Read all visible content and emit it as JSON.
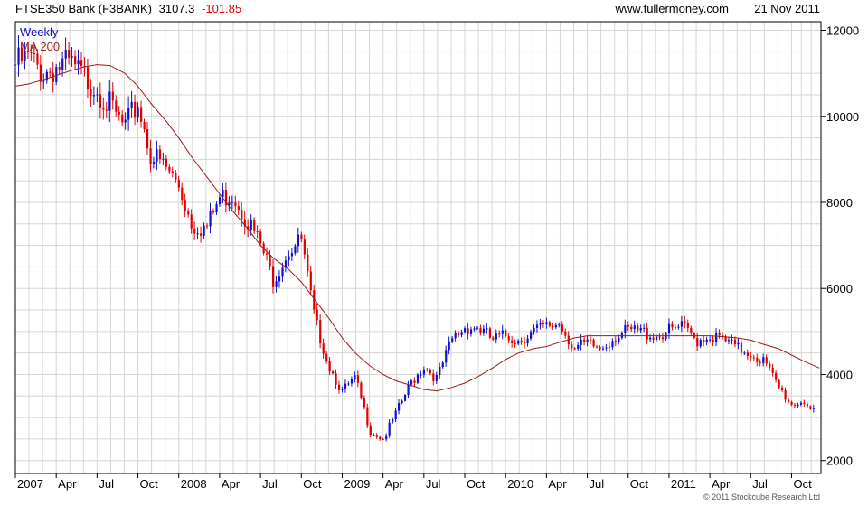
{
  "header": {
    "instrument": "FTSE350 Bank (F3BANK)",
    "last": "3107.3",
    "change": "-101.85",
    "site": "www.fullermoney.com",
    "date": "21 Nov 2011"
  },
  "copyright": "© 2011 Stockcube Research Ltd",
  "colors": {
    "up": "#1010c8",
    "down": "#e00000",
    "ma": "#9b1b1b",
    "grid": "#d6d6d6",
    "frame": "#000000",
    "change": "#e00000",
    "legend_weekly": "#1010c8",
    "legend_ma": "#9b1b1b"
  },
  "chart_data": {
    "type": "line",
    "title": "FTSE350 Bank (F3BANK)",
    "xlabel": "",
    "ylabel": "",
    "xlim": [
      2007.0,
      2011.93
    ],
    "ylim": [
      1700,
      12200
    ],
    "y_axis_side": "right",
    "yticks": [
      2000,
      4000,
      6000,
      8000,
      10000,
      12000
    ],
    "ytick_labels": [
      "2000",
      "4000",
      "6000",
      "8000",
      "10000",
      "12000"
    ],
    "xticks": [
      {
        "x": 2007.0,
        "label": "2007"
      },
      {
        "x": 2007.25,
        "label": "Apr"
      },
      {
        "x": 2007.5,
        "label": "Jul"
      },
      {
        "x": 2007.75,
        "label": "Oct"
      },
      {
        "x": 2008.0,
        "label": "2008"
      },
      {
        "x": 2008.25,
        "label": "Apr"
      },
      {
        "x": 2008.5,
        "label": "Jul"
      },
      {
        "x": 2008.75,
        "label": "Oct"
      },
      {
        "x": 2009.0,
        "label": "2009"
      },
      {
        "x": 2009.25,
        "label": "Apr"
      },
      {
        "x": 2009.5,
        "label": "Jul"
      },
      {
        "x": 2009.75,
        "label": "Oct"
      },
      {
        "x": 2010.0,
        "label": "2010"
      },
      {
        "x": 2010.25,
        "label": "Apr"
      },
      {
        "x": 2010.5,
        "label": "Jul"
      },
      {
        "x": 2010.75,
        "label": "Oct"
      },
      {
        "x": 2011.0,
        "label": "2011"
      },
      {
        "x": 2011.25,
        "label": "Apr"
      },
      {
        "x": 2011.5,
        "label": "Jul"
      },
      {
        "x": 2011.75,
        "label": "Oct"
      }
    ],
    "grid": true,
    "legend": "top-left",
    "series": [
      {
        "name": "Weekly",
        "style": "candlestick-close-approximation",
        "x": [
          2007.0,
          2007.08,
          2007.17,
          2007.25,
          2007.33,
          2007.42,
          2007.5,
          2007.58,
          2007.67,
          2007.75,
          2007.83,
          2007.92,
          2008.0,
          2008.08,
          2008.17,
          2008.25,
          2008.33,
          2008.42,
          2008.5,
          2008.58,
          2008.67,
          2008.75,
          2008.83,
          2008.92,
          2009.0,
          2009.08,
          2009.17,
          2009.25,
          2009.33,
          2009.42,
          2009.5,
          2009.58,
          2009.67,
          2009.75,
          2009.83,
          2009.92,
          2010.0,
          2010.08,
          2010.17,
          2010.25,
          2010.33,
          2010.42,
          2010.5,
          2010.58,
          2010.67,
          2010.75,
          2010.83,
          2010.92,
          2011.0,
          2011.08,
          2011.17,
          2011.25,
          2011.33,
          2011.42,
          2011.5,
          2011.58,
          2011.67,
          2011.75,
          2011.83,
          2011.88
        ],
        "values": [
          11200,
          11350,
          11000,
          11150,
          11200,
          10900,
          10700,
          10200,
          9700,
          10300,
          9100,
          8800,
          8400,
          7500,
          7400,
          8100,
          8200,
          7600,
          7000,
          6200,
          6900,
          7100,
          5300,
          4200,
          3600,
          3900,
          2700,
          2500,
          3100,
          3800,
          4200,
          3900,
          4800,
          5100,
          5100,
          4800,
          4900,
          4800,
          5000,
          5100,
          5200,
          4600,
          4700,
          4600,
          4900,
          5000,
          5000,
          4900,
          5000,
          5100,
          4800,
          4900,
          4800,
          4600,
          4500,
          4300,
          3700,
          3300,
          3400,
          3107.3
        ]
      },
      {
        "name": "MA 200",
        "x": [
          2007.0,
          2007.08,
          2007.17,
          2007.25,
          2007.33,
          2007.42,
          2007.5,
          2007.58,
          2007.67,
          2007.75,
          2007.83,
          2007.92,
          2008.0,
          2008.08,
          2008.17,
          2008.25,
          2008.33,
          2008.42,
          2008.5,
          2008.58,
          2008.67,
          2008.75,
          2008.83,
          2008.92,
          2009.0,
          2009.08,
          2009.17,
          2009.25,
          2009.33,
          2009.42,
          2009.5,
          2009.58,
          2009.67,
          2009.75,
          2009.83,
          2009.92,
          2010.0,
          2010.08,
          2010.17,
          2010.25,
          2010.33,
          2010.42,
          2010.5,
          2010.58,
          2010.67,
          2010.75,
          2010.83,
          2010.92,
          2011.0,
          2011.08,
          2011.17,
          2011.25,
          2011.33,
          2011.42,
          2011.5,
          2011.58,
          2011.67,
          2011.75,
          2011.83,
          2011.92
        ],
        "values": [
          10700,
          10750,
          10850,
          10950,
          11050,
          11150,
          11200,
          11180,
          11000,
          10700,
          10300,
          9900,
          9500,
          9050,
          8600,
          8200,
          7800,
          7400,
          7000,
          6700,
          6450,
          6150,
          5750,
          5300,
          4850,
          4500,
          4200,
          4000,
          3850,
          3750,
          3650,
          3620,
          3700,
          3800,
          3950,
          4150,
          4350,
          4500,
          4600,
          4650,
          4750,
          4850,
          4900,
          4900,
          4900,
          4900,
          4900,
          4900,
          4900,
          4900,
          4900,
          4900,
          4880,
          4850,
          4800,
          4700,
          4600,
          4450,
          4300,
          4150
        ]
      }
    ]
  }
}
